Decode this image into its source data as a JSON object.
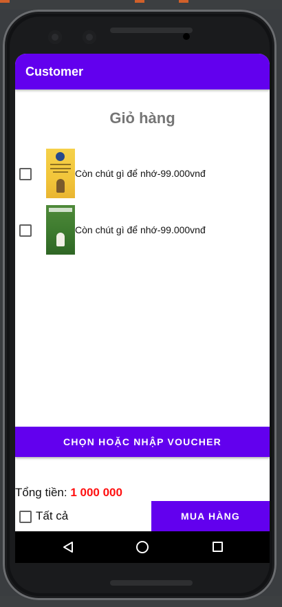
{
  "appbar": {
    "title": "Customer",
    "color": "#6200ee"
  },
  "cart": {
    "title": "Giỏ hàng",
    "items": [
      {
        "label": "Còn chút gì để nhớ-99.000vnđ",
        "checked": false,
        "cover": "book-cover-yellow"
      },
      {
        "label": "Còn chút gì để nhớ-99.000vnđ",
        "checked": false,
        "cover": "book-cover-green"
      }
    ]
  },
  "voucher": {
    "label": "CHỌN HOẶC NHẬP VOUCHER"
  },
  "summary": {
    "total_label": "Tổng tiền: ",
    "total_value": "1 000 000",
    "total_color": "#ff1010",
    "select_all_label": "Tất cả",
    "buy_label": "MUA HÀNG"
  },
  "navigation": {
    "back": "back-icon",
    "home": "home-icon",
    "recent": "recent-apps-icon"
  }
}
